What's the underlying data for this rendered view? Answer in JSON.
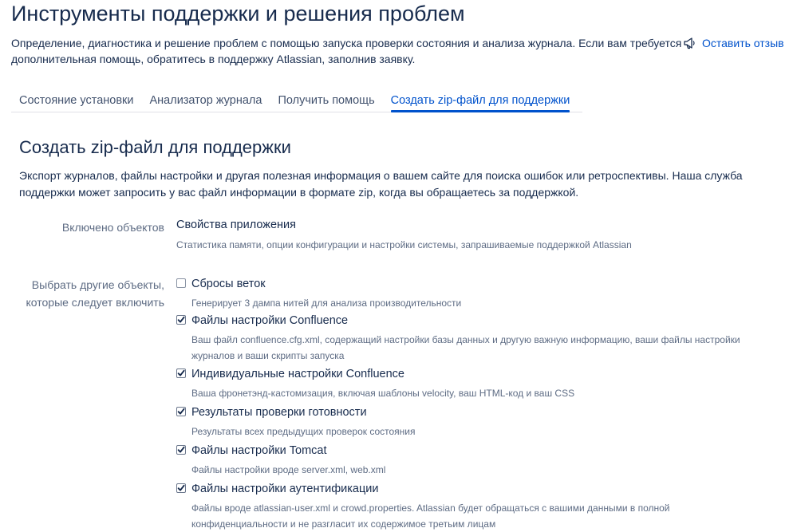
{
  "header": {
    "title": "Инструменты поддержки и решения проблем",
    "intro_line1": "Определение, диагностика и решение проблем с помощью запуска проверки состояния и анализа журнала. Если вам требуется",
    "intro_line2": "дополнительная помощь, обратитесь в поддержку Atlassian, заполнив заявку.",
    "feedback_icon": "megaphone-icon",
    "feedback_label": "Оставить отзыв"
  },
  "tabs": [
    {
      "label": "Состояние установки",
      "active": false
    },
    {
      "label": "Анализатор журнала",
      "active": false
    },
    {
      "label": "Получить помощь",
      "active": false
    },
    {
      "label": "Создать zip-файл для поддержки",
      "active": true
    }
  ],
  "section": {
    "title": "Создать zip-файл для поддержки",
    "desc_line1": "Экспорт журналов, файлы настройки и другая полезная информация о вашем сайте для поиска ошибок или ретроспективы. Наша служба",
    "desc_line2": "поддержки может запросить у вас файл информации в формате zip, когда вы обращаетесь за поддержкой."
  },
  "included": {
    "label": "Включено объектов",
    "title": "Свойства приложения",
    "desc": "Статистика памяти, опции конфигурации и настройки системы, запрашиваемые поддержкой Atlassian"
  },
  "other": {
    "label_line1": "Выбрать другие объекты,",
    "label_line2": "которые следует включить",
    "items": [
      {
        "label": "Сбросы веток",
        "checked": false,
        "desc": [
          "Генерирует 3 дампа нитей для анализа производительности"
        ]
      },
      {
        "label": "Файлы настройки Confluence",
        "checked": true,
        "desc": [
          "Ваш файл confluence.cfg.xml, содержащий настройки базы данных и другую важную информацию, ваши файлы настройки",
          "журналов и ваши скрипты запуска"
        ]
      },
      {
        "label": "Индивидуальные настройки Confluence",
        "checked": true,
        "desc": [
          "Ваша фронетэнд-кастомизация, включая шаблоны velocity, ваш HTML-код и ваш CSS"
        ]
      },
      {
        "label": "Результаты проверки готовности",
        "checked": true,
        "desc": [
          "Результаты всех предыдущих проверок состояния"
        ]
      },
      {
        "label": "Файлы настройки Tomcat",
        "checked": true,
        "desc": [
          "Файлы настройки вроде server.xml, web.xml"
        ]
      },
      {
        "label": "Файлы настройки аутентификации",
        "checked": true,
        "desc": [
          "Файлы вроде atlassian-user.xml и crowd.properties. Atlassian будет обращаться с вашими данными в полной",
          "конфиденциальности и не разгласит их содержимое третьим лицам"
        ]
      }
    ]
  }
}
